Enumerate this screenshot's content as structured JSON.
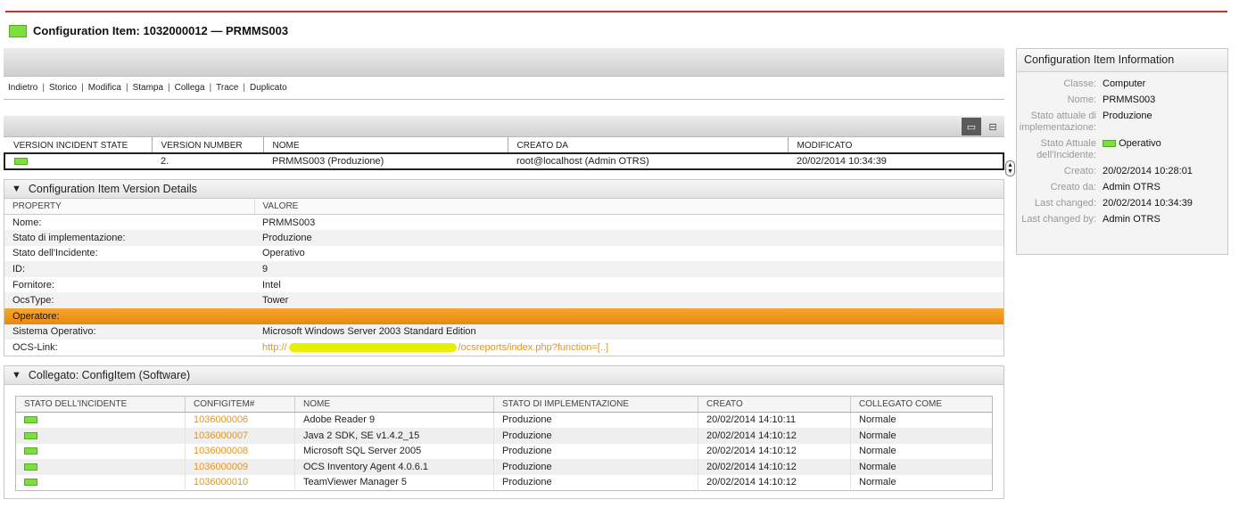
{
  "header": {
    "title": "Configuration Item: 1032000012 — PRMMS003",
    "status_color": "#7be03d"
  },
  "actions": [
    "Indietro",
    "Storico",
    "Modifica",
    "Stampa",
    "Collega",
    "Trace",
    "Duplicato"
  ],
  "version_table": {
    "columns": [
      "VERSION INCIDENT STATE",
      "VERSION NUMBER",
      "NOME",
      "CREATO DA",
      "MODIFICATO"
    ],
    "row": {
      "version_number": "2.",
      "nome": "PRMMS003 (Produzione)",
      "creato_da": "root@localhost (Admin OTRS)",
      "modificato": "20/02/2014 10:34:39"
    }
  },
  "details": {
    "title": "Configuration Item Version Details",
    "columns": [
      "PROPERTY",
      "VALORE"
    ],
    "rows": [
      {
        "property": "Nome:",
        "value": "PRMMS003"
      },
      {
        "property": "Stato di implementazione:",
        "value": "Produzione"
      },
      {
        "property": "Stato dell'Incidente:",
        "value": "Operativo"
      },
      {
        "property": "ID:",
        "value": "9"
      },
      {
        "property": "Fornitore:",
        "value": "Intel"
      },
      {
        "property": "OcsType:",
        "value": "Tower"
      },
      {
        "property": "Operatore:",
        "value": ""
      },
      {
        "property": "Sistema Operativo:",
        "value": "Microsoft Windows Server 2003 Standard Edition"
      }
    ],
    "ocs_link": {
      "property": "OCS-Link:",
      "prefix": "http://",
      "suffix": "/ocsreports/index.php?function=[..]"
    }
  },
  "linked": {
    "title": "Collegato: ConfigItem (Software)",
    "columns": [
      "STATO DELL'INCIDENTE",
      "CONFIGITEM#",
      "NOME",
      "STATO DI IMPLEMENTAZIONE",
      "CREATO",
      "COLLEGATO COME"
    ],
    "rows": [
      {
        "id": "1036000006",
        "nome": "Adobe Reader 9",
        "stato": "Produzione",
        "creato": "20/02/2014 14:10:11",
        "come": "Normale"
      },
      {
        "id": "1036000007",
        "nome": "Java 2 SDK, SE v1.4.2_15",
        "stato": "Produzione",
        "creato": "20/02/2014 14:10:12",
        "come": "Normale"
      },
      {
        "id": "1036000008",
        "nome": "Microsoft SQL Server 2005",
        "stato": "Produzione",
        "creato": "20/02/2014 14:10:12",
        "come": "Normale"
      },
      {
        "id": "1036000009",
        "nome": "OCS Inventory Agent 4.0.6.1",
        "stato": "Produzione",
        "creato": "20/02/2014 14:10:12",
        "come": "Normale"
      },
      {
        "id": "1036000010",
        "nome": "TeamViewer Manager 5",
        "stato": "Produzione",
        "creato": "20/02/2014 14:10:12",
        "come": "Normale"
      }
    ]
  },
  "info": {
    "title": "Configuration Item Information",
    "rows": [
      {
        "label": "Classe:",
        "value": "Computer"
      },
      {
        "label": "Nome:",
        "value": "PRMMS003"
      },
      {
        "label": "Stato attuale di implementazione:",
        "value": "Produzione"
      },
      {
        "label": "Stato Attuale dell'Incidente:",
        "value": "Operativo",
        "swatch": true
      },
      {
        "label": "Creato:",
        "value": "20/02/2014 10:28:01"
      },
      {
        "label": "Creato da:",
        "value": "Admin OTRS"
      },
      {
        "label": "Last changed:",
        "value": "20/02/2014 10:34:39"
      },
      {
        "label": "Last changed by:",
        "value": "Admin OTRS"
      }
    ]
  }
}
